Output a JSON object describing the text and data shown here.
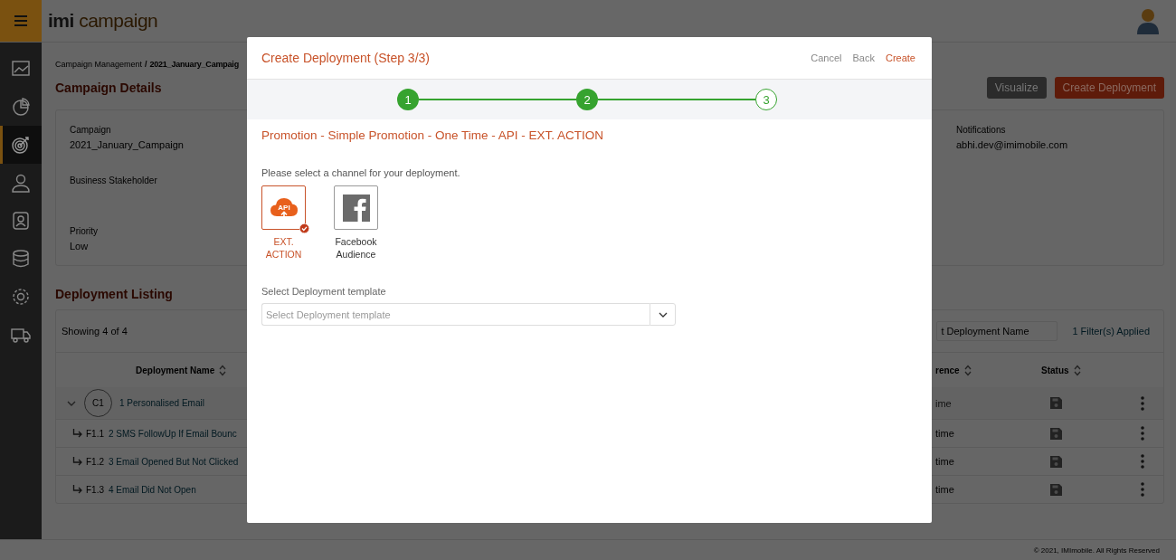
{
  "topbar": {
    "logo_bold": "imi",
    "logo_light": "campaign"
  },
  "sidebar": {
    "items": [
      {
        "kind": "chart",
        "selected": false
      },
      {
        "kind": "pie",
        "selected": false
      },
      {
        "kind": "target",
        "selected": true
      },
      {
        "kind": "agent",
        "selected": false
      },
      {
        "kind": "contact",
        "selected": false
      },
      {
        "kind": "database",
        "selected": false
      },
      {
        "kind": "settings",
        "selected": false
      },
      {
        "kind": "truck",
        "selected": false
      }
    ]
  },
  "breadcrumb": {
    "items": [
      "Campaign Management",
      "2021_January_Campaig"
    ],
    "separator": "/"
  },
  "campaign_details": {
    "title": "Campaign Details",
    "fields": [
      {
        "label": "Campaign",
        "value": "2021_January_Campaign"
      },
      {
        "label": "Business Stakeholder"
      },
      {
        "label": "Priority",
        "value": "Low"
      }
    ],
    "notifications": {
      "label": "Notifications",
      "value": "abhi.dev@imimobile.com"
    }
  },
  "header_buttons": [
    {
      "label": "Visualize",
      "kind": "secondary"
    },
    {
      "label": "Create Deployment",
      "kind": "primary"
    }
  ],
  "deployment_listing": {
    "title": "Deployment Listing",
    "showing": "Showing 4 of 4",
    "search_placeholder": "t Deployment Name",
    "filters": "1 Filter(s) Applied",
    "columns": [
      "Deployment Name",
      "rence",
      "Status"
    ],
    "rows": [
      {
        "code": "C1",
        "name": "1 Personalised Email",
        "column_2": "ime",
        "expanded": true,
        "children": [
          {
            "code": "F1.1",
            "name": "2 SMS FollowUp If Email Bounc",
            "column_2": "time"
          },
          {
            "code": "F1.2",
            "name": "3 Email Opened But Not Clicked",
            "column_2": "time"
          },
          {
            "code": "F1.3",
            "name": "4 Email Did Not Open",
            "column_2": "time"
          }
        ]
      }
    ]
  },
  "footer": "© 2021, IMImobile. All Rights Reserved",
  "modal": {
    "title": "Create Deployment (Step 3/3)",
    "actions": [
      {
        "label": "Cancel",
        "kind": "plain"
      },
      {
        "label": "Back",
        "kind": "plain"
      },
      {
        "label": "Create",
        "kind": "primary"
      }
    ],
    "steps": [
      {
        "label": "1",
        "done": true
      },
      {
        "label": "2",
        "done": true
      },
      {
        "label": "3",
        "done": false
      }
    ],
    "path": "Promotion - Simple Promotion - One Time - API - EXT. ACTION",
    "prompt": "Please select a channel for your deployment.",
    "channels": [
      {
        "label": "EXT. ACTION",
        "kind": "api",
        "icon_text": "API",
        "selected": true
      },
      {
        "label": "Facebook Audience",
        "kind": "facebook",
        "selected": false
      }
    ],
    "template": {
      "label": "Select Deployment template",
      "placeholder": "Select Deployment template"
    }
  }
}
